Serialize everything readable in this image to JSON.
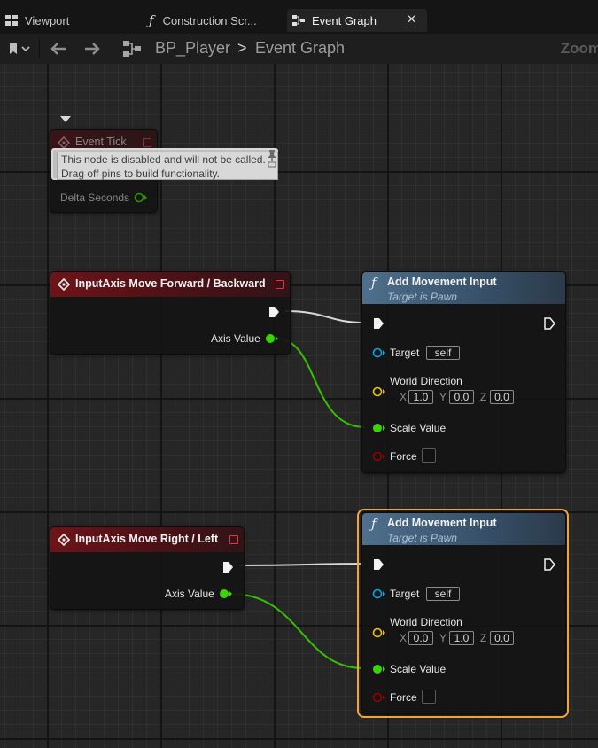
{
  "tabs": [
    {
      "label": "Viewport",
      "icon": "viewport-grid-icon"
    },
    {
      "label": "Construction Scr...",
      "icon": "function-icon"
    },
    {
      "label": "Event Graph",
      "icon": "event-graph-icon",
      "active": true
    }
  ],
  "tab_close": "✕",
  "toolbar": {
    "breadcrumb": [
      "BP_Player",
      "Event Graph"
    ],
    "separator": ">",
    "zoom_label": "Zoom"
  },
  "comment": {
    "line1": "This node is disabled and will not be called.",
    "line2": "Drag off pins to build functionality."
  },
  "nodes": {
    "event_tick": {
      "title": "Event Tick",
      "output_label": "Delta Seconds",
      "disabled": true
    },
    "axis_forward": {
      "title": "InputAxis Move Forward / Backward",
      "output_label": "Axis Value"
    },
    "axis_right": {
      "title": "InputAxis Move Right / Left",
      "output_label": "Axis Value"
    },
    "add_move_1": {
      "title": "Add Movement Input",
      "subtitle": "Target is Pawn",
      "target_label": "Target",
      "target_value": "self",
      "dir_label": "World Direction",
      "axis_x": "X",
      "axis_y": "Y",
      "axis_z": "Z",
      "x": "1.0",
      "y": "0.0",
      "z": "0.0",
      "scale_label": "Scale Value",
      "force_label": "Force"
    },
    "add_move_2": {
      "title": "Add Movement Input",
      "subtitle": "Target is Pawn",
      "target_label": "Target",
      "target_value": "self",
      "dir_label": "World Direction",
      "axis_x": "X",
      "axis_y": "Y",
      "axis_z": "Z",
      "x": "0.0",
      "y": "1.0",
      "z": "0.0",
      "scale_label": "Scale Value",
      "force_label": "Force",
      "selected": true
    }
  },
  "colors": {
    "exec_wire": "#d9d9d9",
    "float_pin": "#38d500",
    "object_pin": "#00a8f0",
    "vector_pin": "#f2c200",
    "bool_pin": "#920101",
    "selection": "#f3a33c",
    "event_header": "#6d1419",
    "function_header": "#4f6f8c"
  }
}
